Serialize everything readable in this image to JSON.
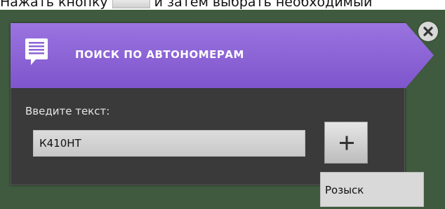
{
  "instruction": {
    "text_before": "Нажать кнопку",
    "text_after": "и затем выбрать необходимый"
  },
  "dialog": {
    "title": "ПОИСК ПО АВТОНОМЕРАМ",
    "header_color": "#8b63d6",
    "header_icon": "chat-list-icon",
    "close_icon": "close-icon",
    "field_label": "Введите текст:",
    "input_value": "К410НТ",
    "add_button_icon": "plus-icon"
  },
  "dropdown": {
    "items": [
      {
        "label": "Розыск"
      }
    ]
  }
}
